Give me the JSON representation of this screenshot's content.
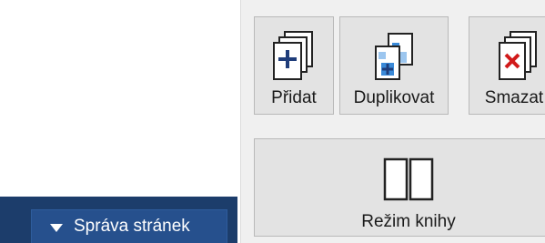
{
  "toolbar": {
    "add_label": "Přidat",
    "add_icon": "add-page-icon",
    "duplicate_label": "Duplikovat",
    "duplicate_icon": "duplicate-page-icon",
    "delete_label": "Smazat",
    "delete_icon": "delete-page-icon",
    "book_mode_label": "Režim knihy",
    "book_mode_icon": "book-icon"
  },
  "bottom_bar": {
    "toggle_label": "Správa stránek",
    "toggle_icon": "triangle-down-icon"
  },
  "colors": {
    "bottom_bar_bg": "#1c3d6b",
    "bottom_button_bg": "#26508d",
    "panel_bg": "#f0f0f0",
    "button_bg": "#e3e3e3",
    "plus_color": "#1f3d7a",
    "delete_x_color": "#d11a1a"
  }
}
